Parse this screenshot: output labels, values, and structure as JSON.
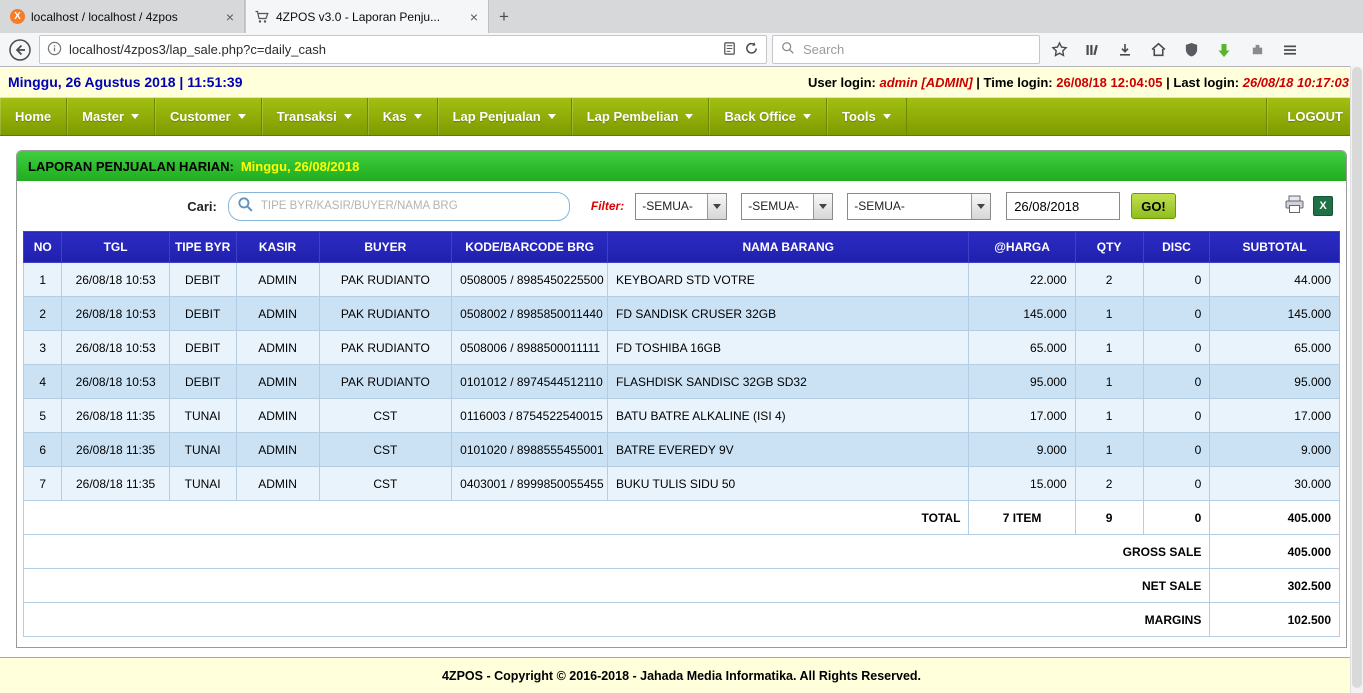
{
  "browser": {
    "tabs": [
      {
        "title": "localhost / localhost / 4zpos"
      },
      {
        "title": "4ZPOS v3.0 - Laporan Penju..."
      }
    ],
    "new_tab_glyph": "+",
    "close_glyph": "×",
    "url": "localhost/4zpos3/lap_sale.php?c=daily_cash",
    "search_placeholder": "Search",
    "toolbar_icons": [
      "back-icon",
      "info-icon",
      "reader-view-icon",
      "reload-icon",
      "search-icon",
      "star-icon",
      "library-icon",
      "downloads-icon",
      "home-icon",
      "shield-icon",
      "green-download-icon",
      "extension-icon",
      "menu-icon"
    ]
  },
  "statusbar": {
    "datetime": "Minggu, 26 Agustus 2018 | 11:51:39",
    "user_login_label": "User login:",
    "user_login_value": "admin [ADMIN]",
    "time_login_label": "| Time login:",
    "time_login_value": "26/08/18 12:04:05",
    "last_login_label": "| Last login:",
    "last_login_value": "26/08/18 10:17:03"
  },
  "menu": {
    "items": [
      {
        "label": "Home",
        "caret": false
      },
      {
        "label": "Master",
        "caret": true
      },
      {
        "label": "Customer",
        "caret": true
      },
      {
        "label": "Transaksi",
        "caret": true
      },
      {
        "label": "Kas",
        "caret": true
      },
      {
        "label": "Lap Penjualan",
        "caret": true
      },
      {
        "label": "Lap Pembelian",
        "caret": true
      },
      {
        "label": "Back Office",
        "caret": true
      },
      {
        "label": "Tools",
        "caret": true
      }
    ],
    "logout_label": "LOGOUT"
  },
  "report": {
    "title": "LAPORAN PENJUALAN HARIAN:",
    "title_date": "Minggu, 26/08/2018",
    "search_label": "Cari:",
    "search_placeholder": "TIPE BYR/KASIR/BUYER/NAMA BRG",
    "filter_label": "Filter:",
    "filter_selects": [
      "-SEMUA-",
      "-SEMUA-",
      "-SEMUA-"
    ],
    "date_value": "26/08/2018",
    "go_label": "GO!",
    "action_icons": [
      "print-icon",
      "excel-export-icon"
    ]
  },
  "table": {
    "headers": [
      "NO",
      "TGL",
      "TIPE BYR",
      "KASIR",
      "BUYER",
      "KODE/BARCODE BRG",
      "NAMA BARANG",
      "@HARGA",
      "QTY",
      "DISC",
      "SUBTOTAL"
    ],
    "rows": [
      [
        "1",
        "26/08/18 10:53",
        "DEBIT",
        "ADMIN",
        "PAK RUDIANTO",
        "0508005 / 8985450225500",
        "KEYBOARD STD VOTRE",
        "22.000",
        "2",
        "0",
        "44.000"
      ],
      [
        "2",
        "26/08/18 10:53",
        "DEBIT",
        "ADMIN",
        "PAK RUDIANTO",
        "0508002 / 8985850011440",
        "FD SANDISK CRUSER 32GB",
        "145.000",
        "1",
        "0",
        "145.000"
      ],
      [
        "3",
        "26/08/18 10:53",
        "DEBIT",
        "ADMIN",
        "PAK RUDIANTO",
        "0508006 / 8988500011111",
        "FD TOSHIBA 16GB",
        "65.000",
        "1",
        "0",
        "65.000"
      ],
      [
        "4",
        "26/08/18 10:53",
        "DEBIT",
        "ADMIN",
        "PAK RUDIANTO",
        "0101012 / 8974544512110",
        "FLASHDISK SANDISC 32GB SD32",
        "95.000",
        "1",
        "0",
        "95.000"
      ],
      [
        "5",
        "26/08/18 11:35",
        "TUNAI",
        "ADMIN",
        "CST",
        "0116003 / 8754522540015",
        "BATU BATRE ALKALINE (ISI 4)",
        "17.000",
        "1",
        "0",
        "17.000"
      ],
      [
        "6",
        "26/08/18 11:35",
        "TUNAI",
        "ADMIN",
        "CST",
        "0101020 / 8988555455001",
        "BATRE EVEREDY 9V",
        "9.000",
        "1",
        "0",
        "9.000"
      ],
      [
        "7",
        "26/08/18 11:35",
        "TUNAI",
        "ADMIN",
        "CST",
        "0403001 / 8999850055455",
        "BUKU TULIS SIDU 50",
        "15.000",
        "2",
        "0",
        "30.000"
      ]
    ],
    "total_row": {
      "label": "TOTAL",
      "item_count": "7 ITEM",
      "qty": "9",
      "disc": "0",
      "subtotal": "405.000"
    },
    "summary_rows": [
      {
        "label": "GROSS SALE",
        "value": "405.000"
      },
      {
        "label": "NET SALE",
        "value": "302.500"
      },
      {
        "label": "MARGINS",
        "value": "102.500"
      }
    ]
  },
  "footer": {
    "text": "4ZPOS - Copyright © 2016-2018 - Jahada Media Informatika. All Rights Reserved."
  },
  "colors": {
    "menu_green": "#8aa806",
    "panel_green": "#2db92d",
    "table_header_blue": "#2323bb",
    "row_light": "#e9f3fb",
    "row_dark": "#cbe2f4",
    "accent_red": "#cc0000",
    "date_blue": "#0000bb",
    "cream": "#ffffdb",
    "yellow_date": "#ffff00"
  }
}
